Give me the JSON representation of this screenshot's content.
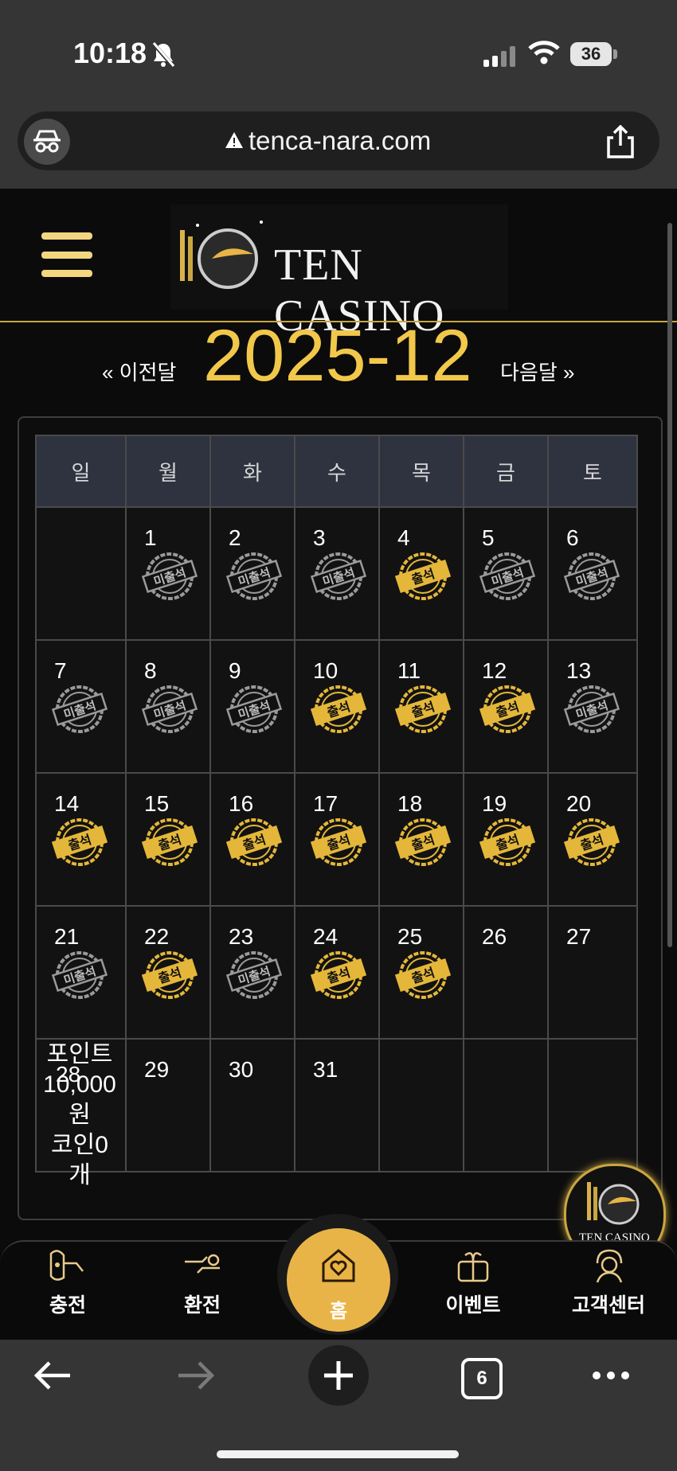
{
  "status": {
    "time": "10:18",
    "battery": "36"
  },
  "browser": {
    "url": "tenca-nara.com",
    "tab_count": "6"
  },
  "header": {
    "logo_text": "TEN CASINO"
  },
  "nav": {
    "prev": "« 이전달",
    "month": "2025-12",
    "next": "다음달 »"
  },
  "calendar": {
    "weekdays": [
      "일",
      "월",
      "화",
      "수",
      "목",
      "금",
      "토"
    ],
    "stamps": {
      "attended": "출석",
      "absent": "미출석"
    },
    "weeks": [
      [
        {
          "day": "",
          "status": ""
        },
        {
          "day": "1",
          "status": "absent"
        },
        {
          "day": "2",
          "status": "absent"
        },
        {
          "day": "3",
          "status": "absent"
        },
        {
          "day": "4",
          "status": "attended"
        },
        {
          "day": "5",
          "status": "absent"
        },
        {
          "day": "6",
          "status": "absent"
        }
      ],
      [
        {
          "day": "7",
          "status": "absent"
        },
        {
          "day": "8",
          "status": "absent"
        },
        {
          "day": "9",
          "status": "absent"
        },
        {
          "day": "10",
          "status": "attended"
        },
        {
          "day": "11",
          "status": "attended"
        },
        {
          "day": "12",
          "status": "attended"
        },
        {
          "day": "13",
          "status": "absent"
        }
      ],
      [
        {
          "day": "14",
          "status": "attended"
        },
        {
          "day": "15",
          "status": "attended"
        },
        {
          "day": "16",
          "status": "attended"
        },
        {
          "day": "17",
          "status": "attended"
        },
        {
          "day": "18",
          "status": "attended"
        },
        {
          "day": "19",
          "status": "attended"
        },
        {
          "day": "20",
          "status": "attended"
        }
      ],
      [
        {
          "day": "21",
          "status": "absent"
        },
        {
          "day": "22",
          "status": "attended"
        },
        {
          "day": "23",
          "status": "absent"
        },
        {
          "day": "24",
          "status": "attended"
        },
        {
          "day": "25",
          "status": "attended"
        },
        {
          "day": "26",
          "status": ""
        },
        {
          "day": "27",
          "status": ""
        }
      ],
      [
        {
          "day": "28",
          "status": ""
        },
        {
          "day": "29",
          "status": ""
        },
        {
          "day": "30",
          "status": ""
        },
        {
          "day": "31",
          "status": ""
        },
        {
          "day": "",
          "status": ""
        },
        {
          "day": "",
          "status": ""
        },
        {
          "day": "",
          "status": ""
        }
      ]
    ],
    "bonus_text": {
      "line1": "포인트",
      "line2": "10,000",
      "line3": "원",
      "line4": "코인0",
      "line5": "개"
    }
  },
  "float_logo": {
    "text": "TEN CASINO"
  },
  "bottom_nav": {
    "charge": "충전",
    "exchange": "환전",
    "home": "홈",
    "event": "이벤트",
    "support": "고객센터"
  },
  "colors": {
    "gold": "#e9b447",
    "accent": "#f2c84b",
    "sunday": "#e03030",
    "saturday": "#6fb8e8"
  }
}
